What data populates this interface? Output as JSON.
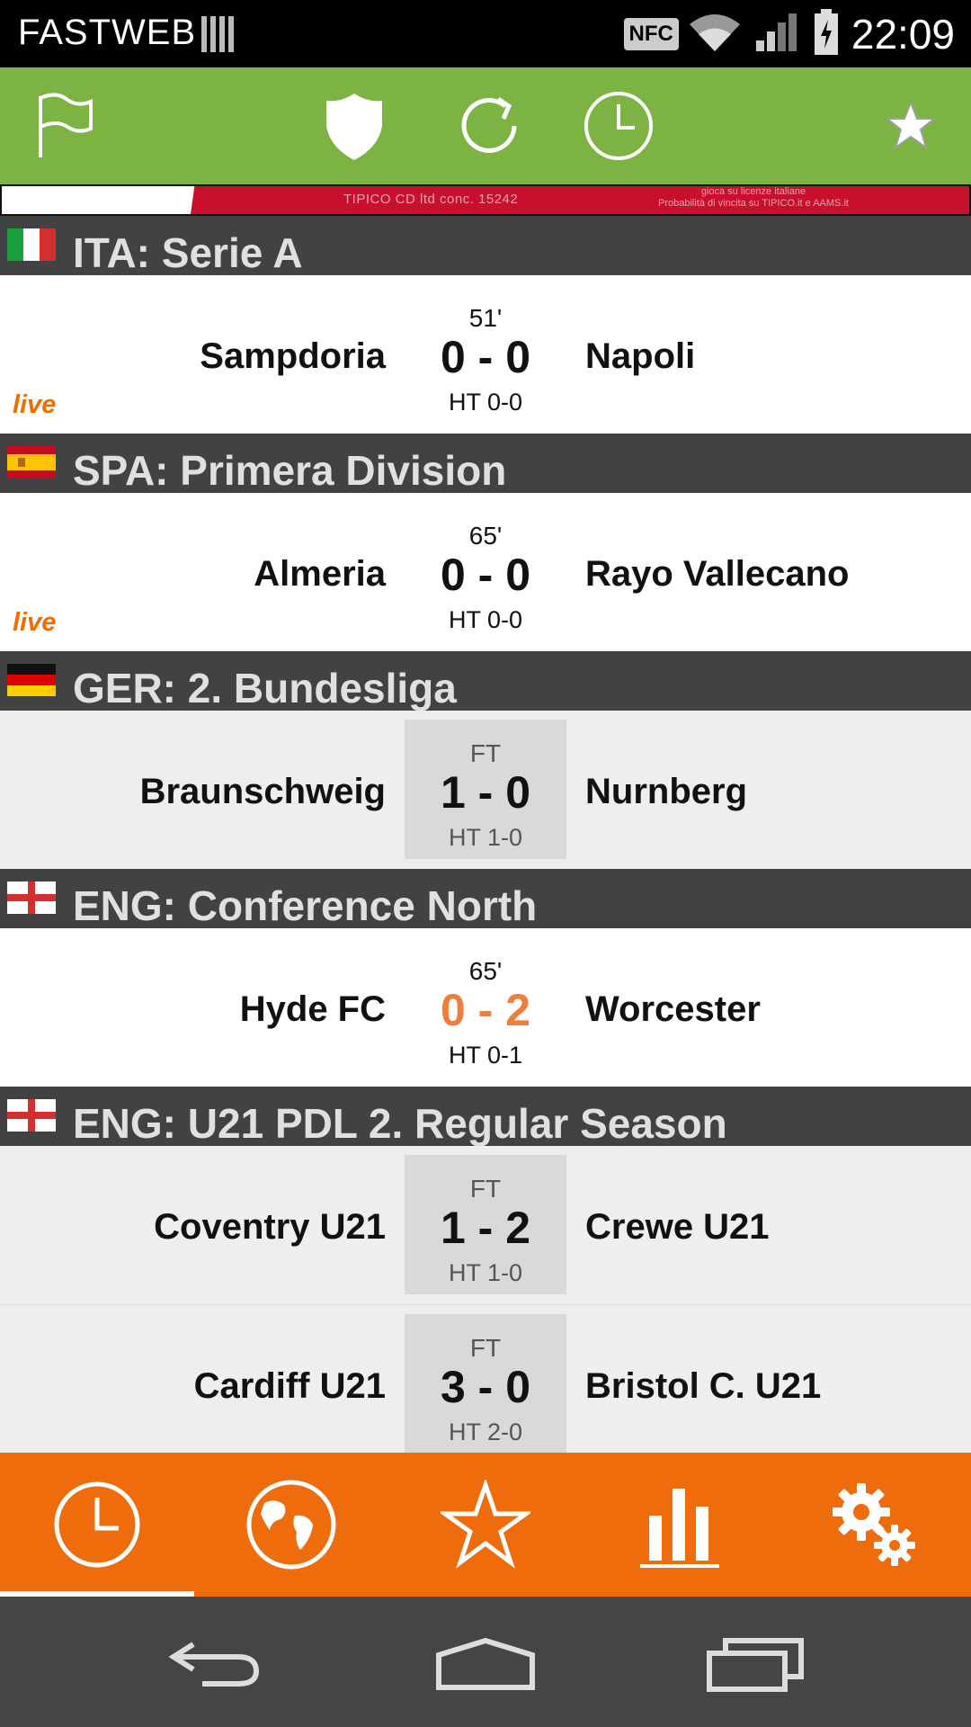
{
  "status_bar": {
    "carrier": "FASTWEB",
    "nfc_label": "NFC",
    "time": "22:09"
  },
  "toolbar": {
    "icons": [
      "flag-icon",
      "shield-icon",
      "refresh-icon",
      "clock-icon",
      "star-icon"
    ]
  },
  "ad": {
    "text": "TIPICO CD ltd conc. 15242",
    "text2_line1": "gioca su licenze italiane",
    "text2_line2": "Probabilità di vincita su TIPICO.it e AAMS.it"
  },
  "leagues": [
    {
      "name": "ITA: Serie A",
      "flag": "italy",
      "matches": [
        {
          "home": "Sampdoria",
          "away": "Napoli",
          "minute": "51'",
          "score": "0 - 0",
          "ht": "HT 0-0",
          "live_label": "live"
        }
      ]
    },
    {
      "name": "SPA: Primera Division",
      "flag": "spain",
      "matches": [
        {
          "home": "Almeria",
          "away": "Rayo Vallecano",
          "minute": "65'",
          "score": "0 - 0",
          "ht": "HT 0-0",
          "live_label": "live"
        }
      ]
    },
    {
      "name": "GER: 2. Bundesliga",
      "flag": "germany",
      "matches": [
        {
          "home": "Braunschweig",
          "away": "Nurnberg",
          "minute": "FT",
          "score": "1 - 0",
          "ht": "HT 1-0"
        }
      ]
    },
    {
      "name": "ENG: Conference North",
      "flag": "england",
      "matches": [
        {
          "home": "Hyde FC",
          "away": "Worcester",
          "minute": "65'",
          "score": "0 - 2",
          "ht": "HT 0-1"
        }
      ]
    },
    {
      "name": "ENG: U21 PDL 2. Regular Season",
      "flag": "england",
      "matches": [
        {
          "home": "Coventry U21",
          "away": "Crewe U21",
          "minute": "FT",
          "score": "1 - 2",
          "ht": "HT 1-0"
        },
        {
          "home": "Cardiff U21",
          "away": "Bristol C. U21",
          "minute": "FT",
          "score": "3 - 0",
          "ht": "HT 2-0"
        }
      ]
    }
  ],
  "tabs": [
    "live-clock-icon",
    "globe-icon",
    "favorites-star-icon",
    "stats-bar-icon",
    "settings-gears-icon"
  ],
  "nav": [
    "back-icon",
    "home-icon",
    "recents-icon"
  ],
  "colors": {
    "toolbar_green": "#7cb342",
    "tab_orange": "#ef6c0c",
    "live_orange": "#ef7d3c",
    "header_gray": "#424242"
  }
}
